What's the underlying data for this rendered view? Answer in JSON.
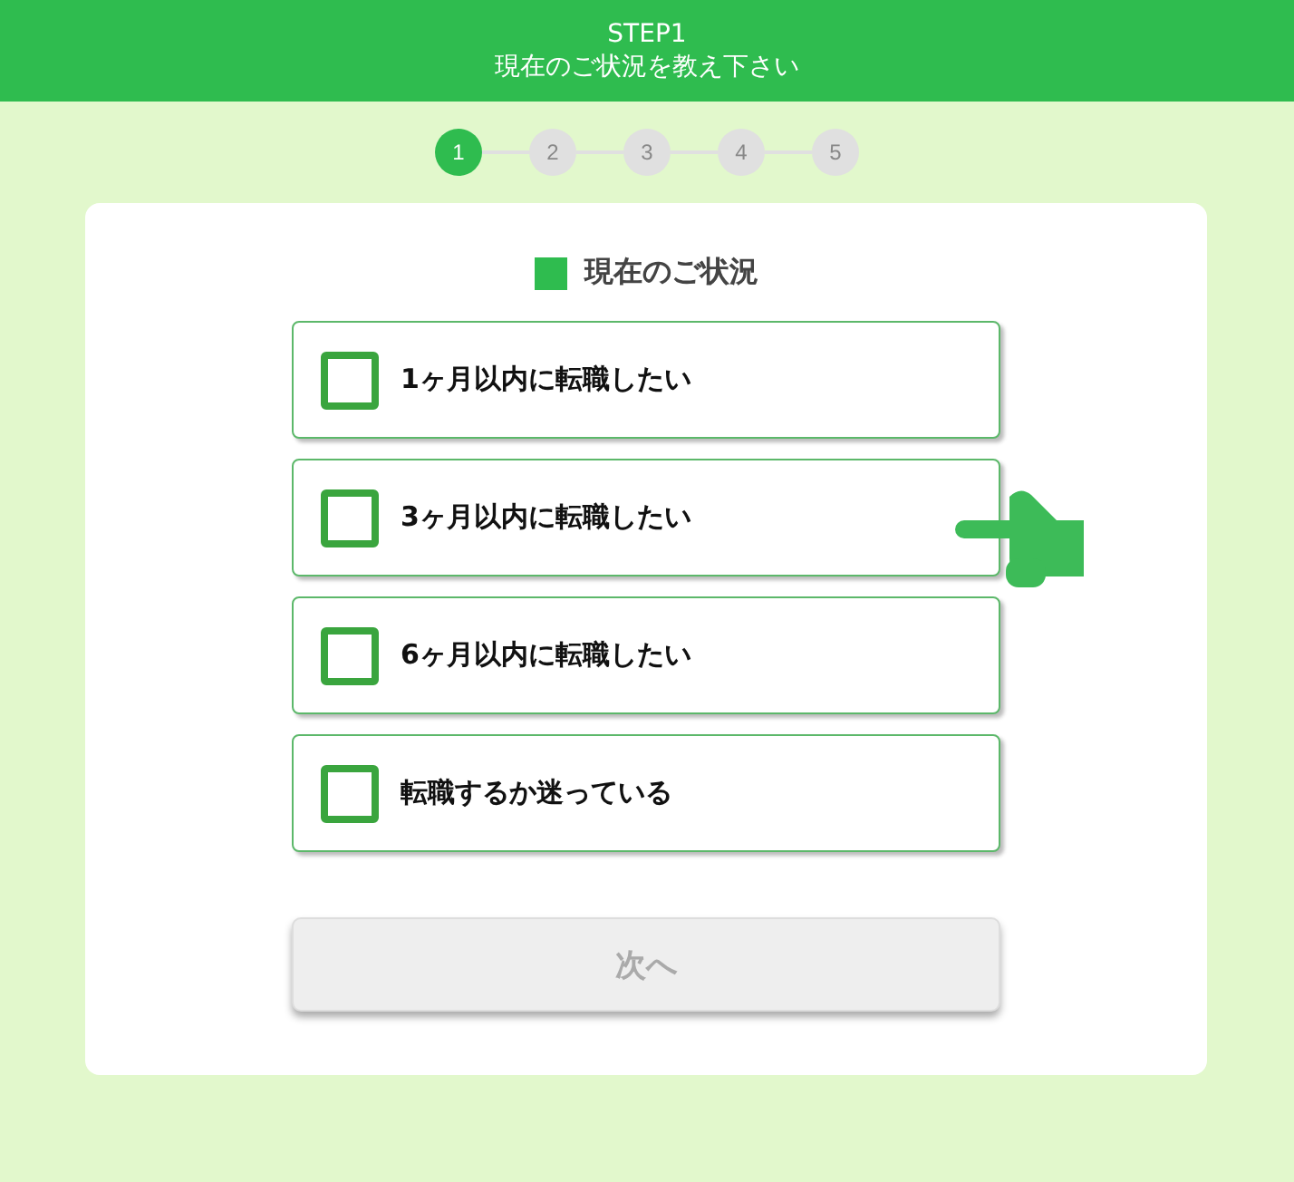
{
  "header": {
    "step": "STEP1",
    "title": "現在のご状況を教え下さい"
  },
  "stepper": [
    {
      "label": "1",
      "selected": true
    },
    {
      "label": "2",
      "selected": false
    },
    {
      "label": "3",
      "selected": false
    },
    {
      "label": "4",
      "selected": false
    },
    {
      "label": "5",
      "selected": false
    }
  ],
  "question": {
    "title": "現在のご状況"
  },
  "options": [
    {
      "label": "1ヶ月以内に転職したい",
      "checked": false
    },
    {
      "label": "3ヶ月以内に転職したい",
      "checked": false
    },
    {
      "label": "6ヶ月以内に転職したい",
      "checked": false
    },
    {
      "label": "転職するか迷っている",
      "checked": false
    }
  ],
  "next_button": {
    "label": "次へ",
    "disabled": true
  }
}
